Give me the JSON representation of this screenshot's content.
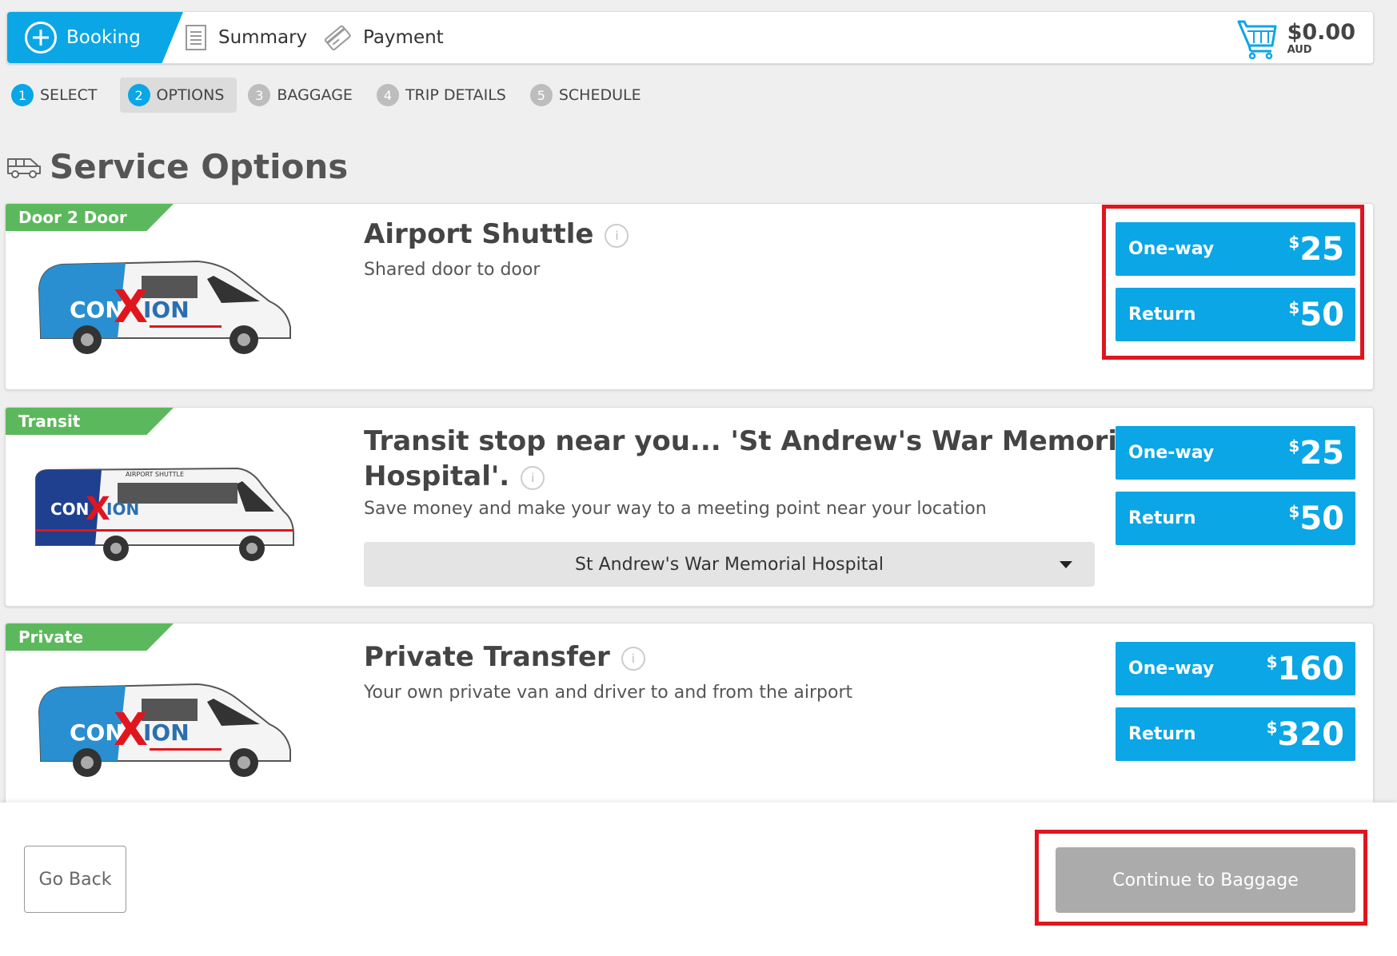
{
  "header": {
    "tabs": {
      "booking": "Booking",
      "summary": "Summary",
      "payment": "Payment"
    },
    "cart": {
      "amount": "$0.00",
      "currency": "AUD"
    }
  },
  "steps": [
    {
      "num": "1",
      "label": "SELECT"
    },
    {
      "num": "2",
      "label": "OPTIONS"
    },
    {
      "num": "3",
      "label": "BAGGAGE"
    },
    {
      "num": "4",
      "label": "TRIP DETAILS"
    },
    {
      "num": "5",
      "label": "SCHEDULE"
    }
  ],
  "page_title": "Service Options",
  "services": [
    {
      "ribbon": "Door 2 Door",
      "title": "Airport Shuttle",
      "subtitle": "Shared door to door",
      "oneway_label": "One-way",
      "oneway_price": "25",
      "return_label": "Return",
      "return_price": "50"
    },
    {
      "ribbon": "Transit",
      "title_line1": "Transit stop near you... 'St Andrew's War Memorial",
      "title_line2": "Hospital'.",
      "subtitle": "Save money and make your way to a meeting point near your location",
      "dropdown_value": "St Andrew's War Memorial Hospital",
      "oneway_label": "One-way",
      "oneway_price": "25",
      "return_label": "Return",
      "return_price": "50"
    },
    {
      "ribbon": "Private",
      "title": "Private Transfer",
      "subtitle": "Your own private van and driver to and from the airport",
      "oneway_label": "One-way",
      "oneway_price": "160",
      "return_label": "Return",
      "return_price": "320"
    }
  ],
  "currency_symbol": "$",
  "van_brand": "CON-X-ION",
  "footer": {
    "back_label": "Go Back",
    "continue_label": "Continue to Baggage"
  },
  "colors": {
    "primary": "#0aa6e6",
    "ribbon": "#5cb85c",
    "highlight": "#e0161f",
    "disabled": "#ababab"
  }
}
